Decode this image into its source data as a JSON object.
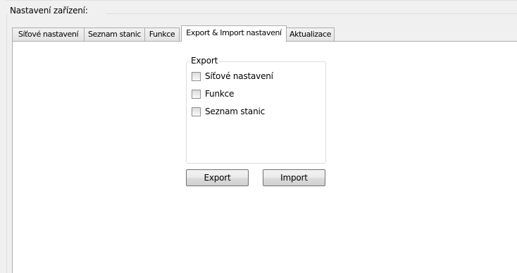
{
  "settings_group": {
    "title": "Nastavení zařízení:"
  },
  "tabs": [
    {
      "label": "Síťové nastavení"
    },
    {
      "label": "Seznam stanic"
    },
    {
      "label": "Funkce"
    },
    {
      "label": "Export & Import nastavení"
    },
    {
      "label": "Aktualizace"
    }
  ],
  "active_tab": "Export & Import nastavení",
  "export_group": {
    "legend": "Export",
    "options": [
      {
        "label": "Síťové nastavení",
        "checked": false
      },
      {
        "label": "Funkce",
        "checked": false
      },
      {
        "label": "Seznam stanic",
        "checked": false
      }
    ]
  },
  "buttons": {
    "export_label": "Export",
    "import_label": "Import"
  }
}
